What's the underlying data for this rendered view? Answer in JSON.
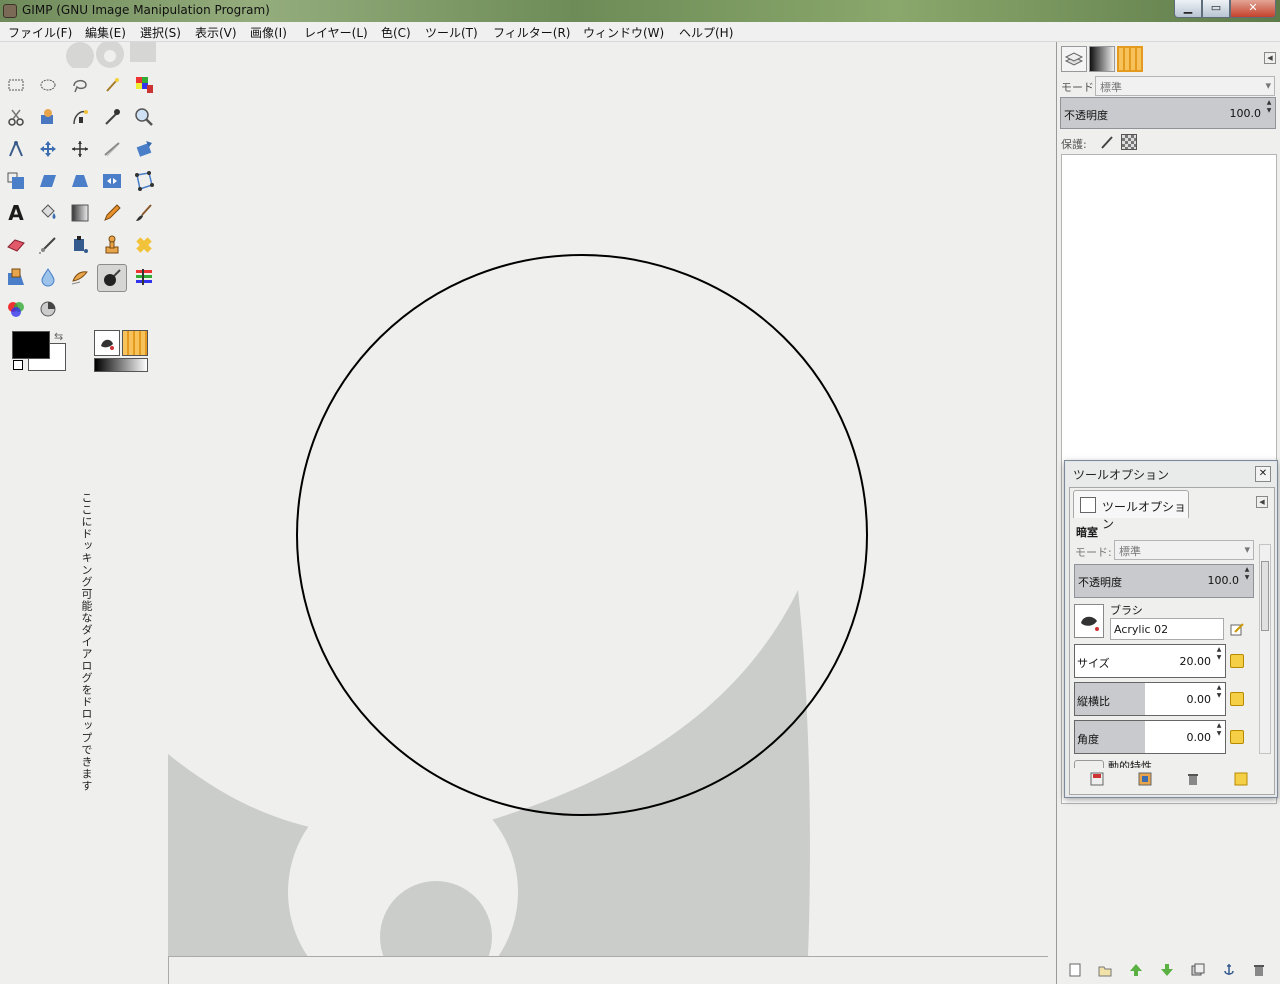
{
  "window": {
    "title": "GIMP (GNU Image Manipulation Program)"
  },
  "menu": [
    "ファイル(F)",
    "編集(E)",
    "選択(S)",
    "表示(V)",
    "画像(I)",
    "レイヤー(L)",
    "色(C)",
    "ツール(T)",
    "フィルター(R)",
    "ウィンドウ(W)",
    "ヘルプ(H)"
  ],
  "toolbox": {
    "tools": [
      "rect-select",
      "ellipse-select",
      "free-select",
      "fuzzy-select",
      "color-select",
      "scissors-select",
      "foreground-select",
      "paths",
      "color-picker",
      "zoom",
      "measure",
      "move",
      "align",
      "crop",
      "rotate",
      "scale",
      "shear",
      "perspective",
      "flip",
      "cage-transform",
      "text",
      "bucket-fill",
      "blend",
      "pencil",
      "paintbrush",
      "eraser",
      "airbrush",
      "ink",
      "clone",
      "heal",
      "perspective-clone",
      "blur-sharpen",
      "smudge",
      "dodge-burn",
      "levels",
      "color-balance",
      "hue-saturation"
    ],
    "active_tool": "dodge-burn",
    "fg_color": "#000000",
    "bg_color": "#ffffff",
    "dock_hint": "ここにドッキング可能なダイアログをドロップできます"
  },
  "layers_dock": {
    "mode_label": "モード:",
    "mode_value": "標準",
    "opacity_label": "不透明度",
    "opacity_value": "100.0",
    "lock_label": "保護:"
  },
  "tool_options": {
    "window_title": "ツールオプション",
    "tab_label": "ツールオプション",
    "tool_name": "暗室",
    "mode_label": "モード:",
    "mode_value": "標準",
    "opacity_label": "不透明度",
    "opacity_value": "100.0",
    "brush_label": "ブラシ",
    "brush_value": "Acrylic 02",
    "size_label": "サイズ",
    "size_value": "20.00",
    "aspect_label": "縦横比",
    "aspect_value": "0.00",
    "angle_label": "角度",
    "angle_value": "0.00",
    "dynamics_label": "動的特性"
  }
}
